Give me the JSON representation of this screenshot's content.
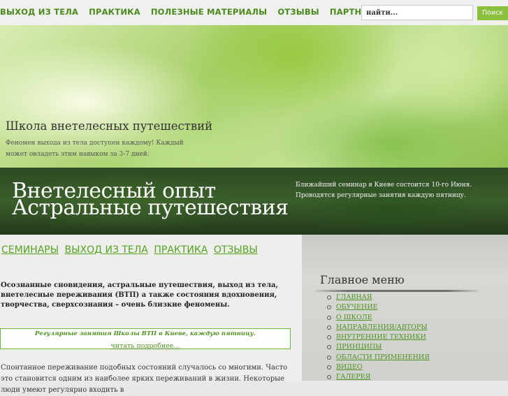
{
  "topnav": [
    "ВЫХОД ИЗ ТЕЛА",
    "ПРАКТИКА",
    "ПОЛЕЗНЫЕ МАТЕРИАЛЫ",
    "ОТЗЫВЫ",
    "ПАРТНЕРСТВО"
  ],
  "search": {
    "value": "найти...",
    "button": "Поиск"
  },
  "banner": {
    "title": "Школа внетелесных путешествий",
    "description": "Феномен выхода из тела доступен каждому! Каждый может овладеть этим навыком за 3-7 дней."
  },
  "hero": {
    "line1": "Внетелесный опыт",
    "line2": "Астральные путешествия",
    "seminar_note": "Ближайший семинар в Киеве состоится 10-го Июня. Проводятся регулярные занятия каждую пятницу."
  },
  "section_nav": [
    "СЕМИНАРЫ",
    "ВЫХОД ИЗ ТЕЛА",
    "ПРАКТИКА",
    "ОТЗЫВЫ"
  ],
  "intro": "Осознанные сновидения, астральные путешествия, выход из тела, внетелесные переживания (ВТП) а также состояния вдохновения, творчества, сверхсознания – очень близкие феномены.",
  "notice": {
    "text": "Регулярные занятия Школы ВТП в Киеве, каждую пятницу.",
    "link": "читать подробнее..."
  },
  "body_text": "Спонтанное переживание подобных состояний случалось со многими. Часто это становится одним из наиболее ярких переживаний в жизни. Некоторые люди умеют регулярно входить в",
  "main_menu": {
    "heading": "Главное меню",
    "items": [
      "ГЛАВНАЯ",
      "ОБУЧЕНИЕ",
      "О ШКОЛЕ",
      "НАПРАВЛЕНИЯ/АВТОРЫ",
      "ВНУТРЕННИЕ ТЕХНИКИ",
      "ПРИНЦИПЫ",
      "ОБЛАСТИ ПРИМЕНЕНИЯ",
      "ВИДЕО",
      "ГАЛЕРЕЯ"
    ]
  },
  "colors": {
    "accent": "#4f9221",
    "nav": "#4a8a1d",
    "search_button": "#8bc03c",
    "dark_strip": "#2d4a22"
  }
}
